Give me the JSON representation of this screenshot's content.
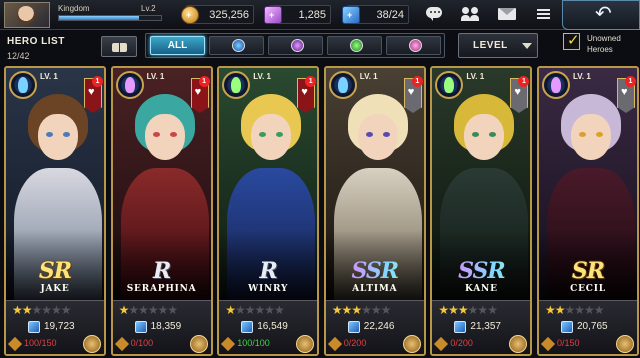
{
  "player": {
    "name": "Kingdom",
    "level": "Lv.2",
    "xp": 0.78
  },
  "resources": {
    "gold": "325,256",
    "gems": "1,285",
    "stamina": "38/24"
  },
  "header": {
    "title": "HERO LIST",
    "count": "12/42"
  },
  "filters": {
    "all_label": "ALL",
    "sort_label": "LEVEL",
    "unowned_label": "Unowned Heroes",
    "unowned_checked": true
  },
  "icons": [
    "person-avatar",
    "gold-coin-icon",
    "gem-icon",
    "stamina-bolt-icon",
    "chat-icon",
    "friends-icon",
    "mail-icon",
    "menu-icon",
    "back-arrow-icon",
    "book-icon"
  ],
  "heroes": [
    {
      "name": "JAKE",
      "rarity": "SR",
      "level": "LV. 1",
      "stars": 2,
      "power": "19,723",
      "fragments": "100/150",
      "fav_badge": "red",
      "notif": "1"
    },
    {
      "name": "SERAPHINA",
      "rarity": "R",
      "level": "LV. 1",
      "stars": 1,
      "power": "18,359",
      "fragments": "0/100",
      "fav_badge": "red",
      "notif": "1"
    },
    {
      "name": "WINRY",
      "rarity": "R",
      "level": "LV. 1",
      "stars": 1,
      "power": "16,549",
      "fragments": "100/100",
      "fav_badge": "red",
      "notif": "1"
    },
    {
      "name": "ALTIMA",
      "rarity": "SSR",
      "level": "LV. 1",
      "stars": 3,
      "power": "22,246",
      "fragments": "0/200",
      "fav_badge": "gray",
      "notif": "1"
    },
    {
      "name": "KANE",
      "rarity": "SSR",
      "level": "LV. 1",
      "stars": 3,
      "power": "21,357",
      "fragments": "0/200",
      "fav_badge": "gray",
      "notif": "1"
    },
    {
      "name": "CECIL",
      "rarity": "SR",
      "level": "LV. 1",
      "stars": 2,
      "power": "20,765",
      "fragments": "0/150",
      "fav_badge": "gray",
      "notif": "1"
    }
  ]
}
